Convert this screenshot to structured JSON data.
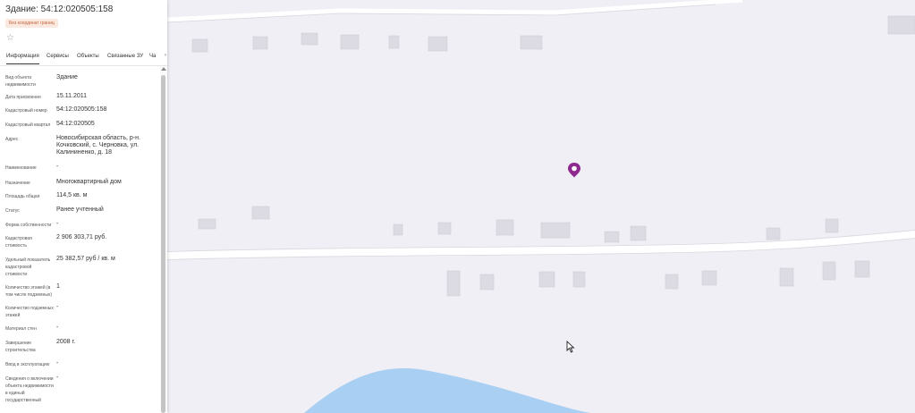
{
  "panel": {
    "title": "Здание: 54:12:020505:158",
    "badge": "Без координат границ",
    "star_icon": "star-icon",
    "tabs": [
      "Информация",
      "Сервисы",
      "Объекты",
      "Связанные ЗУ",
      "Ча"
    ],
    "tab_more_icon": "chevron-right-icon",
    "fields": [
      {
        "label": "Вид объекта недвижимости",
        "value": "Здание"
      },
      {
        "label": "Дата присвоения",
        "value": "15.11.2011"
      },
      {
        "label": "Кадастровый номер",
        "value": "54:12:020505:158"
      },
      {
        "label": "Кадастровый квартал",
        "value": "54:12:020505"
      },
      {
        "label": "Адрес",
        "value": "Новосибирская область, р-н. Кочковский, с. Черновка, ул. Калининенко, д. 18"
      },
      {
        "label": "Наименование",
        "value": "-"
      },
      {
        "label": "Назначение",
        "value": "Многоквартирный дом"
      },
      {
        "label": "Площадь общая",
        "value": "114,5 кв. м"
      },
      {
        "label": "Статус",
        "value": "Ранее учтенный"
      },
      {
        "label": "Форма собственности",
        "value": "-"
      },
      {
        "label": "Кадастровая стоимость",
        "value": "2 906 303,71 руб."
      },
      {
        "label": "Удельный показатель кадастровой стоимости",
        "value": "25 382,57 руб / кв. м"
      },
      {
        "label": "Количество этажей (в том числе подземных)",
        "value": "1"
      },
      {
        "label": "Количество подземных этажей",
        "value": "-"
      },
      {
        "label": "Материал стен",
        "value": "-"
      },
      {
        "label": "Завершение строительства",
        "value": "2008 г."
      },
      {
        "label": "Ввод в эксплуатацию",
        "value": "-"
      },
      {
        "label": "Сведения о включении объекта недвижимости в единый государственный",
        "value": "-"
      }
    ]
  },
  "map": {
    "background_color": "#f0eff6",
    "building_color": "#dcdbe3",
    "road_color": "#ffffff",
    "water_color": "#a9cff2",
    "marker_color": "#8e2a8f",
    "marker_icon": "map-pin-icon",
    "cursor_icon": "mouse-cursor-icon"
  }
}
